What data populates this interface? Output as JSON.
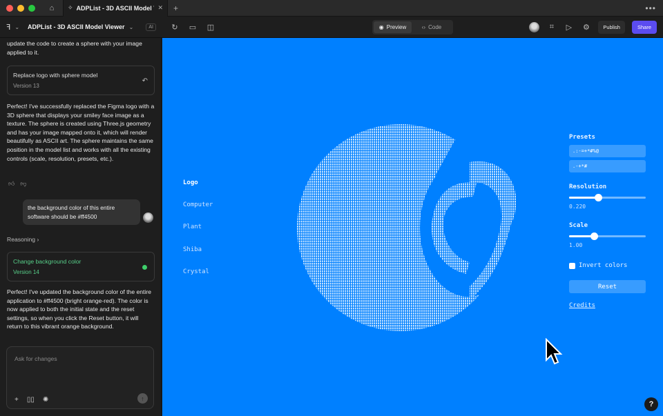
{
  "tab": {
    "title": "ADPList - 3D ASCII Model Viewer"
  },
  "project": {
    "name": "ADPList - 3D ASCII Model Viewer",
    "ai_badge": "AI"
  },
  "view_toggle": {
    "preview": "Preview",
    "code": "Code"
  },
  "actions": {
    "publish": "Publish",
    "share": "Share"
  },
  "chat": {
    "intro_text": "update the code to create a sphere with your image applied to it.",
    "version13": {
      "title": "Replace logo with sphere model",
      "version": "Version 13"
    },
    "reply1": "Perfect! I've successfully replaced the Figma logo with a 3D sphere that displays your smiley face image as a texture. The sphere is created using Three.js geometry and has your image mapped onto it, which will render beautifully as ASCII art. The sphere maintains the same position in the model list and works with all the existing controls (scale, resolution, presets, etc.).",
    "user_message": "the background color of this entire software should be #ff4500",
    "reasoning": "Reasoning",
    "version14": {
      "title": "Change background color",
      "version": "Version 14"
    },
    "reply2": "Perfect! I've updated the background color of the entire application to #ff4500 (bright orange-red). The color is now applied to both the initial state and the reset settings, so when you click the Reset button, it will return to this vibrant orange background.",
    "input_placeholder": "Ask for changes"
  },
  "viewer": {
    "background": "#0080ff",
    "models": [
      "Logo",
      "Computer",
      "Plant",
      "Shiba",
      "Crystal"
    ],
    "selected_model": "Logo",
    "presets_label": "Presets",
    "presets": [
      ".:-=+*#%@",
      ".-+*#"
    ],
    "resolution_label": "Resolution",
    "resolution_value": "0.220",
    "resolution_fraction": 0.38,
    "scale_label": "Scale",
    "scale_value": "1.00",
    "scale_fraction": 0.32,
    "invert_label": "Invert colors",
    "reset_label": "Reset",
    "credits_label": "Credits"
  },
  "help": "?"
}
